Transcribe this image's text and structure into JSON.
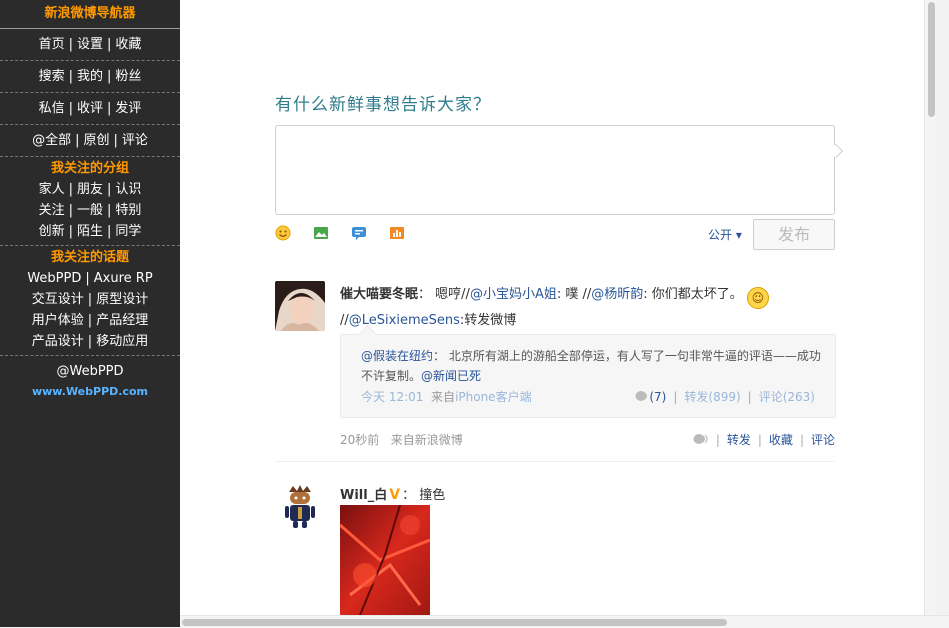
{
  "sidebar": {
    "title": "新浪微博导航器",
    "rows": [
      [
        "首页",
        "设置",
        "收藏"
      ],
      [
        "搜索",
        "我的",
        "粉丝"
      ],
      [
        "私信",
        "收评",
        "发评"
      ],
      [
        "@全部",
        "原创",
        "评论"
      ]
    ],
    "groups_title": "我关注的分组",
    "groups": [
      [
        "家人",
        "朋友",
        "认识"
      ],
      [
        "关注",
        "一般",
        "特别"
      ],
      [
        "创新",
        "陌生",
        "同学"
      ]
    ],
    "topics_title": "我关注的话题",
    "topics": [
      [
        "WebPPD",
        "Axure RP"
      ],
      [
        "交互设计",
        "原型设计"
      ],
      [
        "用户体验",
        "产品经理"
      ],
      [
        "产品设计",
        "移动应用"
      ]
    ],
    "handle": "@WebPPD",
    "site": "www.WebPPD.com",
    "accent_color": "#ff9900",
    "bg_color": "#2b2b2b"
  },
  "composer": {
    "prompt": "有什么新鲜事想告诉大家？",
    "input_value": "",
    "tools": [
      "smile-icon",
      "image-icon",
      "topic-icon",
      "chart-icon"
    ],
    "visibility": "公开 ▾",
    "publish": "发布"
  },
  "feed": [
    {
      "author": "催大喵要冬眠",
      "colon": "：",
      "t1": " 嗯哼//",
      "m1": "@小宝妈小A姐",
      "t2": ": 噗 //",
      "m2": "@杨昕韵",
      "t3": ": 你们都太坏了。",
      "emoji": "☺",
      "t4": "//",
      "m3": "@LeSixiemeSens",
      "t5": ":转发微博",
      "repost": {
        "author": "@假装在纽约",
        "text": "：  北京所有湖上的游船全部停运，有人写了一句非常牛逼的评语——成功不许复制。",
        "link": "@新闻已死",
        "time": "今天 12:01",
        "from_label": "来自",
        "source": "iPhone客户端",
        "likes": "(7)",
        "reposts": "转发(899)",
        "comments": "评论(263)"
      },
      "time": "20秒前",
      "from_label": "来自",
      "source": "新浪微博",
      "actions": {
        "repost": "转发",
        "fav": "收藏",
        "comment": "评论"
      }
    },
    {
      "author": "Will_白",
      "badge": "V",
      "colon": "：",
      "text": " 撞色"
    }
  ]
}
